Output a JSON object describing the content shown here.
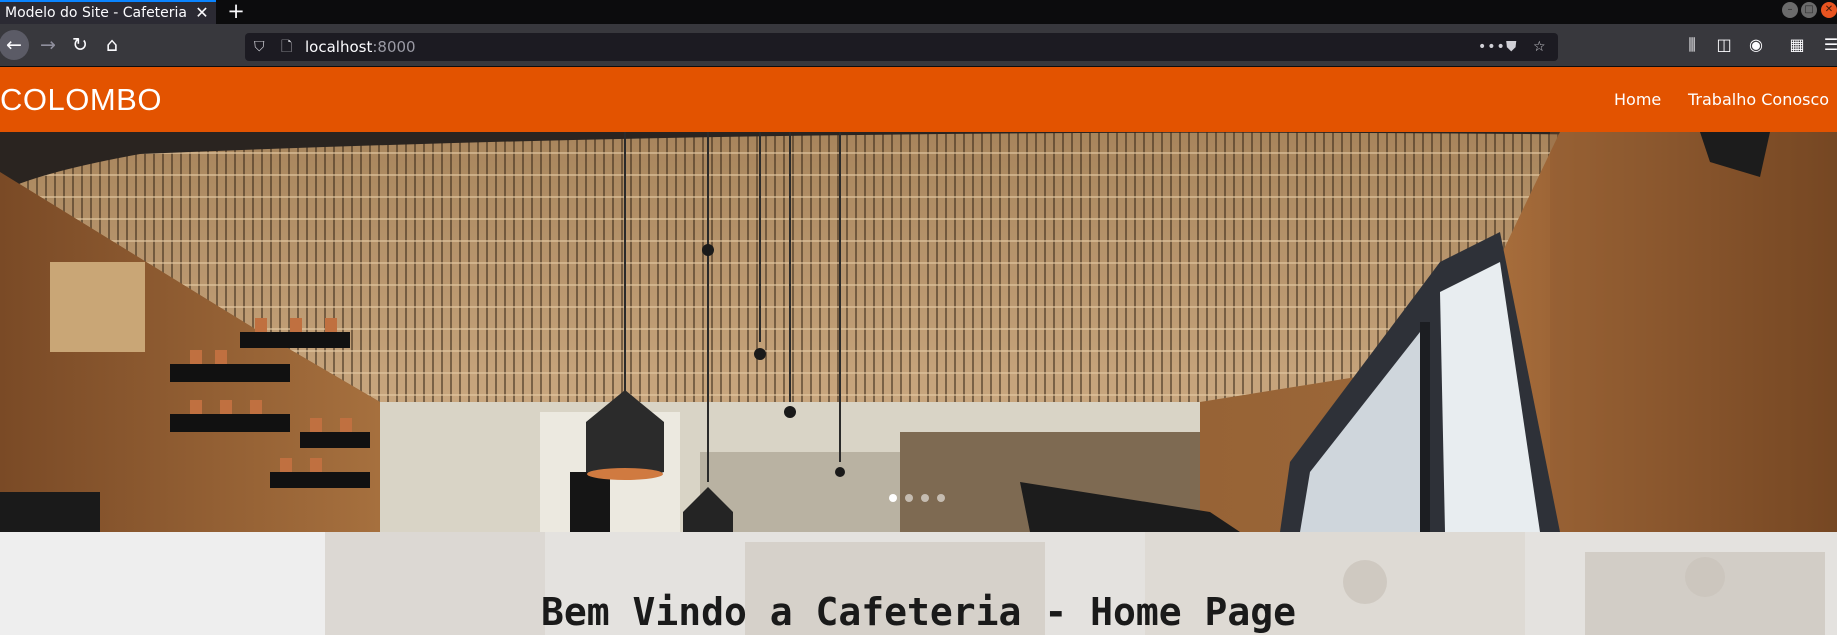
{
  "browser": {
    "tab_title": "Modelo do Site - Cafeteria",
    "tab_close": "✕",
    "new_tab": "+",
    "url_host": "localhost",
    "url_port": ":8000",
    "icons": {
      "back": "arrow-left-icon",
      "forward": "arrow-right-icon",
      "reload": "reload-icon",
      "home": "home-icon",
      "shield": "shield-icon",
      "page": "page-icon",
      "more": "more-icon",
      "pocket": "pocket-icon",
      "bookmark": "star-icon",
      "library": "library-icon",
      "sidebar": "sidebar-icon",
      "account": "account-icon",
      "extensions": "extensions-icon",
      "menu": "hamburger-menu-icon"
    }
  },
  "site": {
    "brand": "COLOMBO",
    "nav": [
      {
        "label": "Home"
      },
      {
        "label": "Trabalho Conosco"
      }
    ],
    "colors": {
      "header": "#e35300"
    }
  },
  "carousel": {
    "slide_count": 4,
    "active_index": 0
  },
  "welcome": {
    "title": "Bem Vindo a Cafeteria - Home Page"
  }
}
